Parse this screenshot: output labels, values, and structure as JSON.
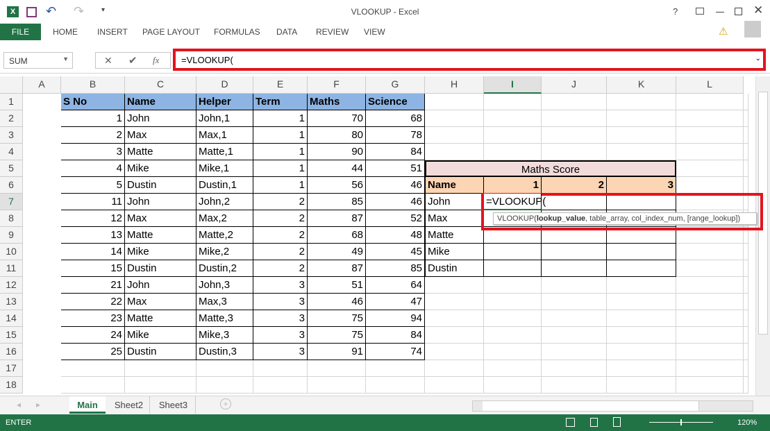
{
  "window": {
    "title": "VLOOKUP - Excel",
    "help": "?"
  },
  "ribbon": {
    "file": "FILE",
    "tabs": [
      "HOME",
      "INSERT",
      "PAGE LAYOUT",
      "FORMULAS",
      "DATA",
      "REVIEW",
      "VIEW"
    ]
  },
  "formula_bar": {
    "name_box": "SUM",
    "formula": "=VLOOKUP(",
    "fx": "fx"
  },
  "columns": [
    "A",
    "B",
    "C",
    "D",
    "E",
    "F",
    "G",
    "H",
    "I",
    "J",
    "K",
    "L"
  ],
  "active_column": "I",
  "active_row": 7,
  "rows": [
    [
      "S No",
      "Name",
      "Helper",
      "Term",
      "Maths",
      "Science"
    ],
    [
      1,
      "John",
      "John,1",
      1,
      70,
      68
    ],
    [
      2,
      "Max",
      "Max,1",
      1,
      80,
      78
    ],
    [
      3,
      "Matte",
      "Matte,1",
      1,
      90,
      84
    ],
    [
      4,
      "Mike",
      "Mike,1",
      1,
      44,
      51
    ],
    [
      5,
      "Dustin",
      "Dustin,1",
      1,
      56,
      46
    ],
    [
      11,
      "John",
      "John,2",
      2,
      85,
      46
    ],
    [
      12,
      "Max",
      "Max,2",
      2,
      87,
      52
    ],
    [
      13,
      "Matte",
      "Matte,2",
      2,
      68,
      48
    ],
    [
      14,
      "Mike",
      "Mike,2",
      2,
      49,
      45
    ],
    [
      15,
      "Dustin",
      "Dustin,2",
      2,
      87,
      85
    ],
    [
      21,
      "John",
      "John,3",
      3,
      51,
      64
    ],
    [
      22,
      "Max",
      "Max,3",
      3,
      46,
      47
    ],
    [
      23,
      "Matte",
      "Matte,3",
      3,
      75,
      94
    ],
    [
      24,
      "Mike",
      "Mike,3",
      3,
      75,
      84
    ],
    [
      25,
      "Dustin",
      "Dustin,3",
      3,
      91,
      74
    ]
  ],
  "row_count": 18,
  "score_table": {
    "title": "Maths Score",
    "header": [
      "Name",
      "1",
      "2",
      "3"
    ],
    "names": [
      "John",
      "Max",
      "Matte",
      "Mike",
      "Dustin"
    ],
    "editing": "=VLOOKUP("
  },
  "tooltip": {
    "fn": "VLOOKUP(",
    "bold_arg": "lookup_value",
    "rest": ", table_array, col_index_num, [range_lookup])"
  },
  "sheets": [
    {
      "name": "Main",
      "active": true
    },
    {
      "name": "Sheet2"
    },
    {
      "name": "Sheet3"
    }
  ],
  "status": {
    "mode": "ENTER",
    "zoom": "120%",
    "zoom_level": 120
  },
  "colors": {
    "accent": "#217346",
    "header_fill": "#8db4e2",
    "score_title_fill": "#f2dcdb",
    "score_header_fill": "#fcd5b4",
    "highlight": "#e3131e"
  }
}
